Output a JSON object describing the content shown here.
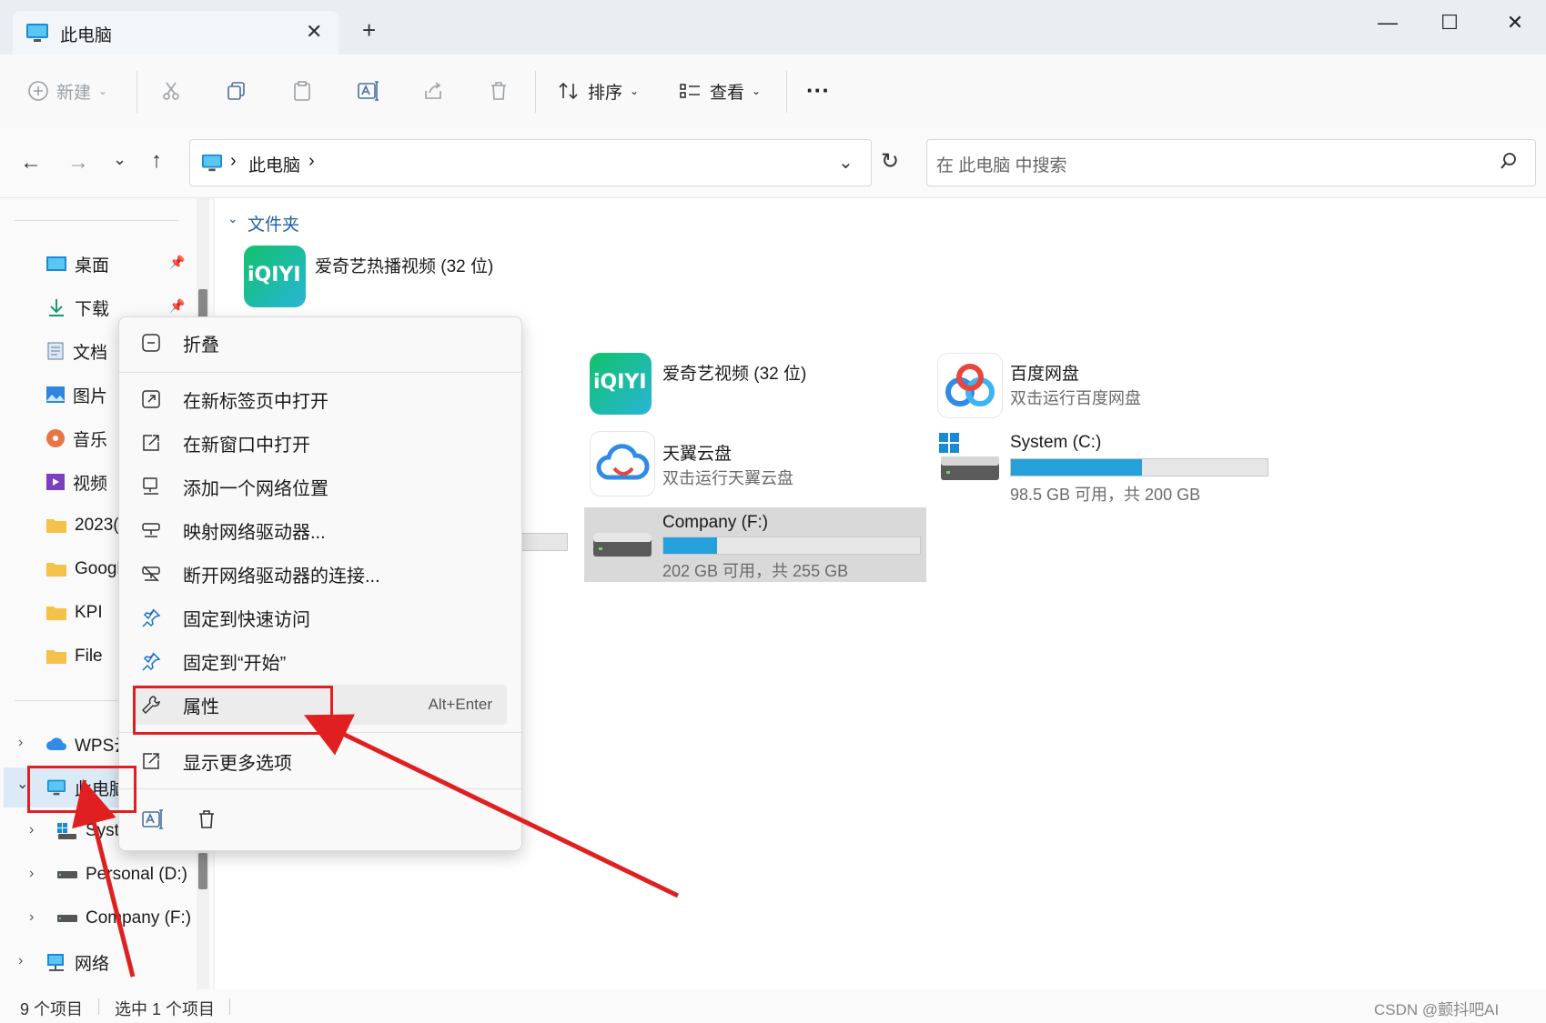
{
  "window": {
    "tab_title": "此电脑",
    "new_tab": "+",
    "minimize": "—",
    "maximize": "☐",
    "close": "✕"
  },
  "toolbar": {
    "new_label": "新建",
    "sort_label": "排序",
    "view_label": "查看",
    "more_label": "···"
  },
  "address": {
    "breadcrumb_root": "此电脑",
    "chevron": "›",
    "search_placeholder": "在 此电脑 中搜索"
  },
  "nav": {
    "items": [
      {
        "label": "桌面"
      },
      {
        "label": "下载"
      },
      {
        "label": "文档"
      },
      {
        "label": "图片"
      },
      {
        "label": "音乐"
      },
      {
        "label": "视频"
      },
      {
        "label": "2023("
      },
      {
        "label": "Googl"
      },
      {
        "label": "KPI"
      },
      {
        "label": "File"
      }
    ],
    "tree": [
      {
        "label": "WPS云"
      },
      {
        "label": "此电脑"
      },
      {
        "label": "Syste"
      },
      {
        "label": "Personal (D:)"
      },
      {
        "label": "Company (F:)"
      },
      {
        "label": "网络"
      }
    ]
  },
  "main": {
    "group_title": "文件夹",
    "tiles": [
      {
        "name": "爱奇艺热播视频 (32 位)",
        "logo": "iQIYI"
      },
      {
        "name": "爱奇艺视频 (32 位)",
        "logo": "iQIYI"
      },
      {
        "name": "百度网盘",
        "sub": "双击运行百度网盘"
      },
      {
        "name": "天翼云盘",
        "sub": "双击运行天翼云盘"
      },
      {
        "name": "System (C:)",
        "sub": "98.5 GB 可用，共 200 GB",
        "used_fraction": 0.51
      },
      {
        "name": "Company (F:)",
        "sub": "202 GB 可用，共 255 GB",
        "used_fraction": 0.21
      }
    ]
  },
  "context_menu": {
    "items": [
      {
        "label": "折叠"
      },
      {
        "label": "在新标签页中打开"
      },
      {
        "label": "在新窗口中打开"
      },
      {
        "label": "添加一个网络位置"
      },
      {
        "label": "映射网络驱动器..."
      },
      {
        "label": "断开网络驱动器的连接..."
      },
      {
        "label": "固定到快速访问"
      },
      {
        "label": "固定到“开始”"
      },
      {
        "label": "属性",
        "shortcut": "Alt+Enter"
      },
      {
        "label": "显示更多选项"
      }
    ]
  },
  "status": {
    "count": "9 个项目",
    "selected": "选中 1 个项目",
    "watermark": "CSDN @颤抖吧AI"
  },
  "colors": {
    "accent": "#26a0da",
    "annotation": "#e02020",
    "group_title": "#1f5fa8"
  }
}
